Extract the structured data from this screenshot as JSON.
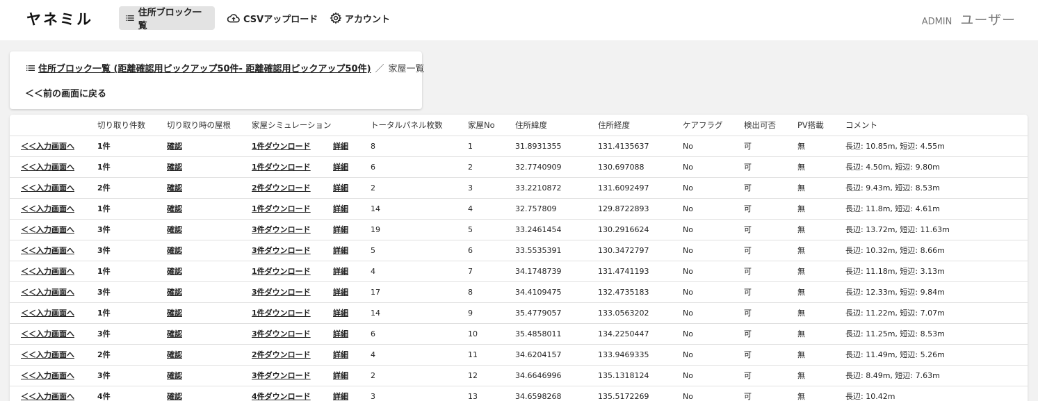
{
  "app": {
    "logo": "ヤネミル"
  },
  "nav": [
    {
      "label": "住所ブロック一覧",
      "icon": "list-icon",
      "active": true
    },
    {
      "label": "CSVアップロード",
      "icon": "cloud-upload-icon",
      "active": false
    },
    {
      "label": "アカウント",
      "icon": "gear-icon",
      "active": false
    }
  ],
  "user": {
    "role": "ADMIN",
    "name": "ユーザー"
  },
  "breadcrumb": {
    "link": "住所ブロック一覧 (距離確認用ピックアップ50件- 距離確認用ピックアップ50件)",
    "separator": "／",
    "current": "家屋一覧",
    "back": "＜＜前の画面に戻る"
  },
  "table": {
    "headers": [
      "",
      "切り取り件数",
      "切り取り時の屋根",
      "家屋シミュレーション",
      "",
      "トータルパネル枚数",
      "家屋No",
      "住所緯度",
      "住所経度",
      "ケアフラグ",
      "検出可否",
      "PV搭載",
      "コメント"
    ],
    "rows": [
      {
        "input": "＜＜入力画面へ",
        "count": "1件",
        "roof": "確認",
        "download": "1件ダウンロード",
        "detail": "詳細",
        "panels": "8",
        "no": "1",
        "lat": "31.8931355",
        "lng": "131.4135637",
        "care": "No",
        "detect": "可",
        "pv": "無",
        "comment": "長辺: 10.85m, 短辺: 4.55m"
      },
      {
        "input": "＜＜入力画面へ",
        "count": "1件",
        "roof": "確認",
        "download": "1件ダウンロード",
        "detail": "詳細",
        "panels": "6",
        "no": "2",
        "lat": "32.7740909",
        "lng": "130.697088",
        "care": "No",
        "detect": "可",
        "pv": "無",
        "comment": "長辺: 4.50m, 短辺: 9.80m"
      },
      {
        "input": "＜＜入力画面へ",
        "count": "2件",
        "roof": "確認",
        "download": "2件ダウンロード",
        "detail": "詳細",
        "panels": "2",
        "no": "3",
        "lat": "33.2210872",
        "lng": "131.6092497",
        "care": "No",
        "detect": "可",
        "pv": "無",
        "comment": "長辺: 9.43m, 短辺: 8.53m"
      },
      {
        "input": "＜＜入力画面へ",
        "count": "1件",
        "roof": "確認",
        "download": "1件ダウンロード",
        "detail": "詳細",
        "panels": "14",
        "no": "4",
        "lat": "32.757809",
        "lng": "129.8722893",
        "care": "No",
        "detect": "可",
        "pv": "無",
        "comment": "長辺: 11.8m, 短辺: 4.61m"
      },
      {
        "input": "＜＜入力画面へ",
        "count": "3件",
        "roof": "確認",
        "download": "3件ダウンロード",
        "detail": "詳細",
        "panels": "19",
        "no": "5",
        "lat": "33.2461454",
        "lng": "130.2916624",
        "care": "No",
        "detect": "可",
        "pv": "無",
        "comment": "長辺: 13.72m, 短辺: 11.63m"
      },
      {
        "input": "＜＜入力画面へ",
        "count": "3件",
        "roof": "確認",
        "download": "3件ダウンロード",
        "detail": "詳細",
        "panels": "5",
        "no": "6",
        "lat": "33.5535391",
        "lng": "130.3472797",
        "care": "No",
        "detect": "可",
        "pv": "無",
        "comment": "長辺: 10.32m, 短辺: 8.66m"
      },
      {
        "input": "＜＜入力画面へ",
        "count": "1件",
        "roof": "確認",
        "download": "1件ダウンロード",
        "detail": "詳細",
        "panels": "4",
        "no": "7",
        "lat": "34.1748739",
        "lng": "131.4741193",
        "care": "No",
        "detect": "可",
        "pv": "無",
        "comment": "長辺: 11.18m, 短辺: 3.13m"
      },
      {
        "input": "＜＜入力画面へ",
        "count": "3件",
        "roof": "確認",
        "download": "3件ダウンロード",
        "detail": "詳細",
        "panels": "17",
        "no": "8",
        "lat": "34.4109475",
        "lng": "132.4735183",
        "care": "No",
        "detect": "可",
        "pv": "無",
        "comment": "長辺: 12.33m, 短辺: 9.84m"
      },
      {
        "input": "＜＜入力画面へ",
        "count": "1件",
        "roof": "確認",
        "download": "1件ダウンロード",
        "detail": "詳細",
        "panels": "14",
        "no": "9",
        "lat": "35.4779057",
        "lng": "133.0563202",
        "care": "No",
        "detect": "可",
        "pv": "無",
        "comment": "長辺: 11.22m, 短辺: 7.07m"
      },
      {
        "input": "＜＜入力画面へ",
        "count": "3件",
        "roof": "確認",
        "download": "3件ダウンロード",
        "detail": "詳細",
        "panels": "6",
        "no": "10",
        "lat": "35.4858011",
        "lng": "134.2250447",
        "care": "No",
        "detect": "可",
        "pv": "無",
        "comment": "長辺: 11.25m, 短辺: 8.53m"
      },
      {
        "input": "＜＜入力画面へ",
        "count": "2件",
        "roof": "確認",
        "download": "2件ダウンロード",
        "detail": "詳細",
        "panels": "4",
        "no": "11",
        "lat": "34.6204157",
        "lng": "133.9469335",
        "care": "No",
        "detect": "可",
        "pv": "無",
        "comment": "長辺: 11.49m, 短辺: 5.26m"
      },
      {
        "input": "＜＜入力画面へ",
        "count": "3件",
        "roof": "確認",
        "download": "3件ダウンロード",
        "detail": "詳細",
        "panels": "2",
        "no": "12",
        "lat": "34.6646996",
        "lng": "135.1318124",
        "care": "No",
        "detect": "可",
        "pv": "無",
        "comment": "長辺: 8.49m, 短辺: 7.63m"
      },
      {
        "input": "＜＜入力画面へ",
        "count": "4件",
        "roof": "確認",
        "download": "4件ダウンロード",
        "detail": "詳細",
        "panels": "3",
        "no": "13",
        "lat": "34.6598268",
        "lng": "135.5172269",
        "care": "No",
        "detect": "可",
        "pv": "無",
        "comment": "長辺: 10.42m"
      }
    ]
  }
}
